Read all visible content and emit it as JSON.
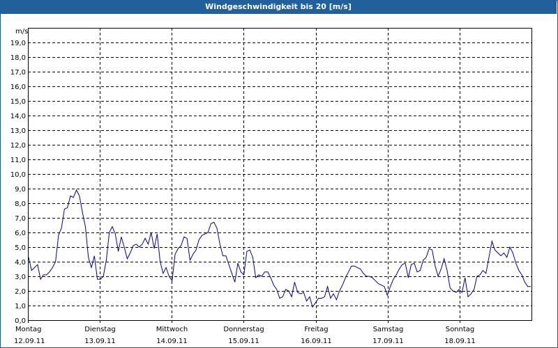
{
  "window": {
    "title": "Windgeschwindigkeit bis 20 [m/s]"
  },
  "chart_data": {
    "type": "line",
    "title": "Windgeschwindigkeit bis 20 [m/s]",
    "ylabel": "m/s",
    "ylim": [
      0,
      20
    ],
    "y_ticks": [
      "0,0",
      "1,0",
      "2,0",
      "3,0",
      "4,0",
      "5,0",
      "6,0",
      "7,0",
      "8,0",
      "9,0",
      "10,0",
      "11,0",
      "12,0",
      "13,0",
      "14,0",
      "15,0",
      "16,0",
      "17,0",
      "18,0",
      "19,0"
    ],
    "grid": true,
    "x_categories": [
      {
        "day": "Montag",
        "date": "12.09.11"
      },
      {
        "day": "Dienstag",
        "date": "13.09.11"
      },
      {
        "day": "Mittwoch",
        "date": "14.09.11"
      },
      {
        "day": "Donnerstag",
        "date": "15.09.11"
      },
      {
        "day": "Freitag",
        "date": "16.09.11"
      },
      {
        "day": "Samstag",
        "date": "17.09.11"
      },
      {
        "day": "Sonntag",
        "date": "18.09.11"
      }
    ],
    "series": [
      {
        "color": "#000099",
        "values": [
          4.3,
          3.4,
          3.6,
          3.8,
          2.8,
          3.1,
          3.1,
          3.3,
          3.6,
          4.0,
          5.8,
          6.3,
          7.6,
          7.7,
          8.5,
          8.4,
          8.9,
          8.5,
          7.4,
          6.4,
          4.3,
          3.6,
          4.4,
          2.8,
          2.8,
          3.0,
          4.1,
          6.0,
          6.4,
          5.9,
          4.7,
          5.7,
          5.0,
          4.2,
          4.6,
          5.1,
          5.2,
          5.0,
          5.2,
          5.6,
          5.2,
          6.0,
          4.9,
          5.9,
          4.0,
          3.2,
          3.6,
          3.0,
          2.7,
          4.5,
          4.9,
          5.1,
          5.7,
          5.6,
          4.1,
          4.5,
          4.8,
          5.5,
          5.8,
          5.9,
          6.0,
          6.6,
          6.7,
          6.3,
          5.2,
          4.4,
          4.4,
          3.8,
          3.2,
          2.6,
          3.9,
          3.3,
          3.1,
          4.7,
          4.8,
          4.3,
          2.9,
          3.1,
          3.0,
          3.3,
          3.3,
          2.9,
          2.4,
          2.1,
          1.5,
          1.6,
          2.1,
          2.0,
          1.6,
          2.6,
          1.9,
          1.8,
          1.9,
          1.3,
          1.6,
          0.9,
          1.2,
          1.5,
          1.5,
          1.6,
          2.3,
          1.5,
          1.8,
          1.4,
          2.0,
          2.4,
          2.9,
          3.3,
          3.7,
          3.7,
          3.6,
          3.5,
          3.2,
          3.0,
          3.0,
          2.9,
          2.7,
          2.5,
          2.4,
          2.3,
          1.7,
          2.3,
          2.8,
          3.1,
          3.5,
          3.8,
          3.9,
          2.9,
          3.8,
          3.9,
          3.3,
          3.4,
          4.1,
          4.3,
          4.9,
          4.8,
          3.7,
          3.0,
          3.5,
          4.2,
          3.4,
          2.2,
          2.0,
          1.9,
          2.1,
          1.9,
          2.9,
          1.6,
          1.8,
          2.1,
          3.0,
          3.1,
          3.4,
          3.2,
          4.3,
          5.4,
          4.8,
          4.6,
          4.4,
          4.6,
          4.3,
          5.0,
          4.6,
          3.9,
          3.4,
          3.1,
          2.6,
          2.3,
          2.3
        ]
      }
    ]
  }
}
